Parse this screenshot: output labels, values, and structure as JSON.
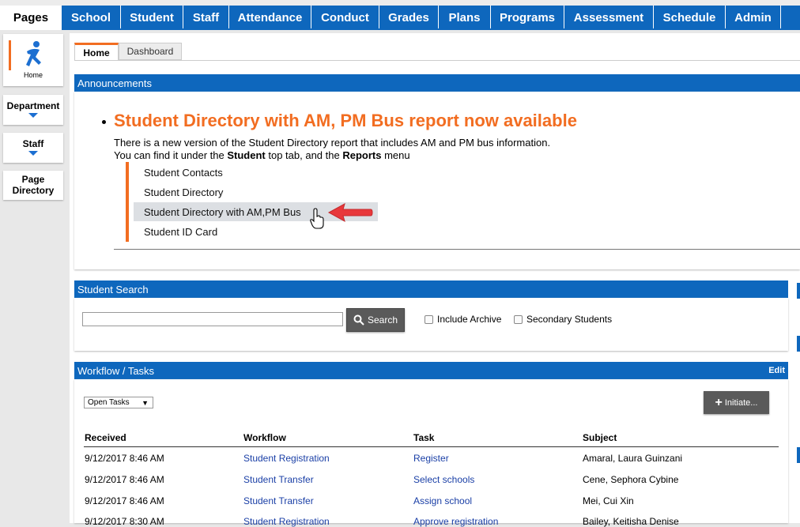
{
  "nav": {
    "pages": "Pages",
    "tabs": [
      "School",
      "Student",
      "Staff",
      "Attendance",
      "Conduct",
      "Grades",
      "Plans",
      "Programs",
      "Assessment",
      "Schedule",
      "Admin"
    ]
  },
  "sidebar": {
    "home": "Home",
    "department": "Department",
    "staff": "Staff",
    "page_directory_1": "Page",
    "page_directory_2": "Directory"
  },
  "subtabs": {
    "home": "Home",
    "dashboard": "Dashboard"
  },
  "announcements": {
    "header": "Announcements",
    "headline": "Student Directory with AM, PM Bus report now available",
    "line1": "There is a new version of the Student Directory report that includes AM and PM bus information.",
    "line2_a": "You can find it under the ",
    "line2_b": "Student",
    "line2_c": " top tab, and the ",
    "line2_d": "Reports",
    "line2_e": " menu",
    "menu_items": [
      "Student Contacts",
      "Student Directory",
      "Student Directory with AM,PM Bus",
      "Student ID Card"
    ]
  },
  "student_search": {
    "header": "Student Search",
    "input_value": "",
    "search_label": "Search",
    "include_archive": "Include Archive",
    "secondary_students": "Secondary Students"
  },
  "workflow": {
    "header": "Workflow / Tasks",
    "edit": "Edit",
    "filter_value": "Open Tasks",
    "initiate": "Initiate...",
    "columns": [
      "Received",
      "Workflow",
      "Task",
      "Subject"
    ],
    "rows": [
      [
        "9/12/2017 8:46 AM",
        "Student Registration",
        "Register",
        "Amaral, Laura Guinzani"
      ],
      [
        "9/12/2017 8:46 AM",
        "Student Transfer",
        "Select schools",
        "Cene, Sephora Cybine"
      ],
      [
        "9/12/2017 8:46 AM",
        "Student Transfer",
        "Assign school",
        "Mei, Cui Xin"
      ],
      [
        "9/12/2017 8:30 AM",
        "Student Registration",
        "Approve registration",
        "Bailey, Keitisha Denise"
      ]
    ]
  },
  "colors": {
    "nav_blue": "#0e67bd",
    "accent_orange": "#f26d21",
    "link_blue": "#1a3fa6"
  }
}
